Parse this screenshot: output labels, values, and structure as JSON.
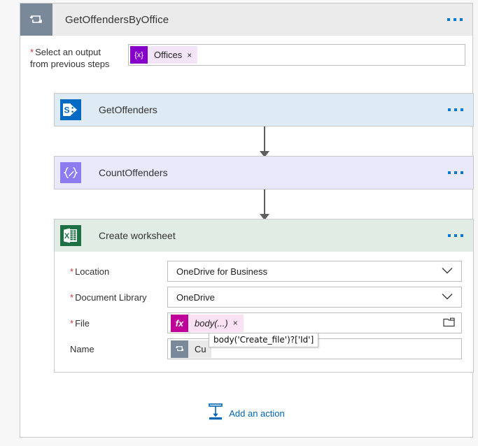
{
  "scope": {
    "title": "GetOffendersByOffice",
    "icon": "loop-icon",
    "menu_icon": "ellipsis-icon"
  },
  "select_output": {
    "label_line1": "Select an output",
    "label_line2": "from previous steps",
    "required_marker": "*",
    "token": {
      "badge": "{x}",
      "text": "Offices",
      "remove": "×"
    }
  },
  "actions": [
    {
      "id": "get-offenders",
      "title": "GetOffenders",
      "icon": "sharepoint-icon",
      "header_color": "#deeaf4"
    },
    {
      "id": "count-offenders",
      "title": "CountOffenders",
      "icon": "compose-icon",
      "header_color": "#eae9fb"
    },
    {
      "id": "create-worksheet",
      "title": "Create worksheet",
      "icon": "excel-icon",
      "header_color": "#e1ece4"
    }
  ],
  "create_worksheet_form": {
    "fields": [
      {
        "label": "Location",
        "required": true,
        "type": "dropdown",
        "value": "OneDrive for Business"
      },
      {
        "label": "Document Library",
        "required": true,
        "type": "dropdown",
        "value": "OneDrive"
      },
      {
        "label": "File",
        "required": true,
        "type": "token",
        "token_badge": "fx",
        "token_text": "body(...)",
        "token_remove": "×",
        "picker_icon": "folder-icon"
      },
      {
        "label": "Name",
        "required": false,
        "type": "token",
        "token_badge": "loop-icon",
        "token_text": "Cu",
        "tooltip": "body('Create_file')?['Id']"
      }
    ]
  },
  "add_action": {
    "label": "Add an action",
    "icon": "insert-action-icon"
  },
  "colors": {
    "accent_blue": "#0078d4",
    "link_blue": "#0065b3",
    "required_red": "#d13438",
    "sharepoint_blue": "#036ac4",
    "compose_purple": "#8d7cf0",
    "excel_green": "#1e7145",
    "loop_slate": "#7a8999",
    "variable_purple": "#8600c9",
    "fx_magenta": "#bf0099"
  }
}
